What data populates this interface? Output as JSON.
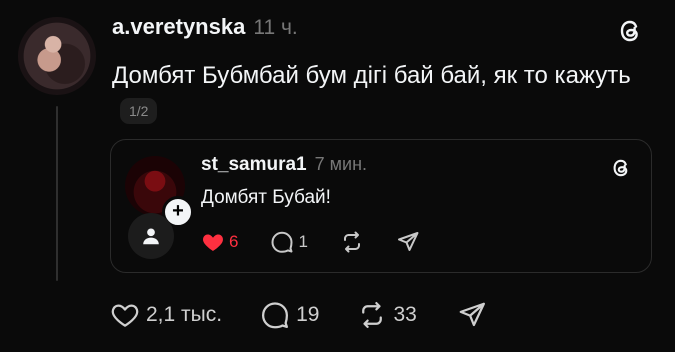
{
  "post": {
    "username": "a.veretynska",
    "time": "11 ч.",
    "text": "Домбят Бубмбай бум дігі бай бай, як то кажуть",
    "page_indicator": "1/2"
  },
  "quoted_post": {
    "username": "st_samura1",
    "time": "7 мин.",
    "text": "Домбят Бубай!",
    "likes": "6",
    "replies": "1",
    "accent_like_color": "#ff3040"
  },
  "actions": {
    "likes": "2,1 тыс.",
    "replies": "19",
    "reposts": "33"
  }
}
